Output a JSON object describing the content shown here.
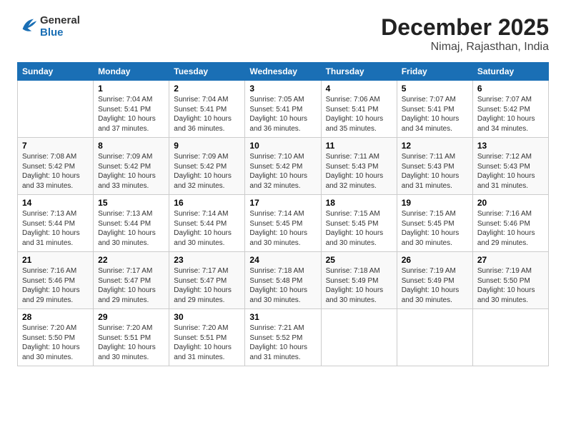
{
  "header": {
    "logo_general": "General",
    "logo_blue": "Blue",
    "month_title": "December 2025",
    "location": "Nimaj, Rajasthan, India"
  },
  "days_of_week": [
    "Sunday",
    "Monday",
    "Tuesday",
    "Wednesday",
    "Thursday",
    "Friday",
    "Saturday"
  ],
  "weeks": [
    [
      {
        "day": "",
        "info": ""
      },
      {
        "day": "1",
        "info": "Sunrise: 7:04 AM\nSunset: 5:41 PM\nDaylight: 10 hours and 37 minutes."
      },
      {
        "day": "2",
        "info": "Sunrise: 7:04 AM\nSunset: 5:41 PM\nDaylight: 10 hours and 36 minutes."
      },
      {
        "day": "3",
        "info": "Sunrise: 7:05 AM\nSunset: 5:41 PM\nDaylight: 10 hours and 36 minutes."
      },
      {
        "day": "4",
        "info": "Sunrise: 7:06 AM\nSunset: 5:41 PM\nDaylight: 10 hours and 35 minutes."
      },
      {
        "day": "5",
        "info": "Sunrise: 7:07 AM\nSunset: 5:41 PM\nDaylight: 10 hours and 34 minutes."
      },
      {
        "day": "6",
        "info": "Sunrise: 7:07 AM\nSunset: 5:42 PM\nDaylight: 10 hours and 34 minutes."
      }
    ],
    [
      {
        "day": "7",
        "info": "Sunrise: 7:08 AM\nSunset: 5:42 PM\nDaylight: 10 hours and 33 minutes."
      },
      {
        "day": "8",
        "info": "Sunrise: 7:09 AM\nSunset: 5:42 PM\nDaylight: 10 hours and 33 minutes."
      },
      {
        "day": "9",
        "info": "Sunrise: 7:09 AM\nSunset: 5:42 PM\nDaylight: 10 hours and 32 minutes."
      },
      {
        "day": "10",
        "info": "Sunrise: 7:10 AM\nSunset: 5:42 PM\nDaylight: 10 hours and 32 minutes."
      },
      {
        "day": "11",
        "info": "Sunrise: 7:11 AM\nSunset: 5:43 PM\nDaylight: 10 hours and 32 minutes."
      },
      {
        "day": "12",
        "info": "Sunrise: 7:11 AM\nSunset: 5:43 PM\nDaylight: 10 hours and 31 minutes."
      },
      {
        "day": "13",
        "info": "Sunrise: 7:12 AM\nSunset: 5:43 PM\nDaylight: 10 hours and 31 minutes."
      }
    ],
    [
      {
        "day": "14",
        "info": "Sunrise: 7:13 AM\nSunset: 5:44 PM\nDaylight: 10 hours and 31 minutes."
      },
      {
        "day": "15",
        "info": "Sunrise: 7:13 AM\nSunset: 5:44 PM\nDaylight: 10 hours and 30 minutes."
      },
      {
        "day": "16",
        "info": "Sunrise: 7:14 AM\nSunset: 5:44 PM\nDaylight: 10 hours and 30 minutes."
      },
      {
        "day": "17",
        "info": "Sunrise: 7:14 AM\nSunset: 5:45 PM\nDaylight: 10 hours and 30 minutes."
      },
      {
        "day": "18",
        "info": "Sunrise: 7:15 AM\nSunset: 5:45 PM\nDaylight: 10 hours and 30 minutes."
      },
      {
        "day": "19",
        "info": "Sunrise: 7:15 AM\nSunset: 5:45 PM\nDaylight: 10 hours and 30 minutes."
      },
      {
        "day": "20",
        "info": "Sunrise: 7:16 AM\nSunset: 5:46 PM\nDaylight: 10 hours and 29 minutes."
      }
    ],
    [
      {
        "day": "21",
        "info": "Sunrise: 7:16 AM\nSunset: 5:46 PM\nDaylight: 10 hours and 29 minutes."
      },
      {
        "day": "22",
        "info": "Sunrise: 7:17 AM\nSunset: 5:47 PM\nDaylight: 10 hours and 29 minutes."
      },
      {
        "day": "23",
        "info": "Sunrise: 7:17 AM\nSunset: 5:47 PM\nDaylight: 10 hours and 29 minutes."
      },
      {
        "day": "24",
        "info": "Sunrise: 7:18 AM\nSunset: 5:48 PM\nDaylight: 10 hours and 30 minutes."
      },
      {
        "day": "25",
        "info": "Sunrise: 7:18 AM\nSunset: 5:49 PM\nDaylight: 10 hours and 30 minutes."
      },
      {
        "day": "26",
        "info": "Sunrise: 7:19 AM\nSunset: 5:49 PM\nDaylight: 10 hours and 30 minutes."
      },
      {
        "day": "27",
        "info": "Sunrise: 7:19 AM\nSunset: 5:50 PM\nDaylight: 10 hours and 30 minutes."
      }
    ],
    [
      {
        "day": "28",
        "info": "Sunrise: 7:20 AM\nSunset: 5:50 PM\nDaylight: 10 hours and 30 minutes."
      },
      {
        "day": "29",
        "info": "Sunrise: 7:20 AM\nSunset: 5:51 PM\nDaylight: 10 hours and 30 minutes."
      },
      {
        "day": "30",
        "info": "Sunrise: 7:20 AM\nSunset: 5:51 PM\nDaylight: 10 hours and 31 minutes."
      },
      {
        "day": "31",
        "info": "Sunrise: 7:21 AM\nSunset: 5:52 PM\nDaylight: 10 hours and 31 minutes."
      },
      {
        "day": "",
        "info": ""
      },
      {
        "day": "",
        "info": ""
      },
      {
        "day": "",
        "info": ""
      }
    ]
  ]
}
